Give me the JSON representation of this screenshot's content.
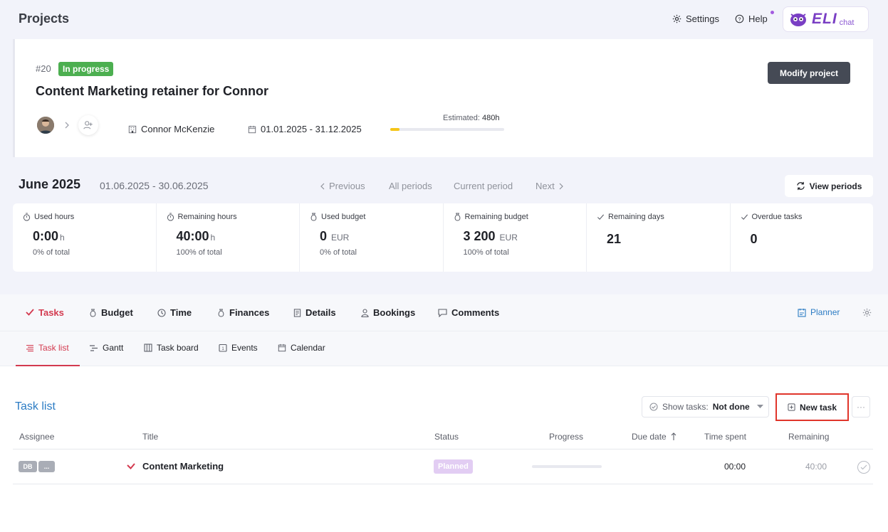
{
  "header": {
    "title": "Projects",
    "settings_label": "Settings",
    "help_label": "Help",
    "eli_brand": "ELI",
    "eli_chat": "chat"
  },
  "project": {
    "number": "#20",
    "status": "In progress",
    "title": "Content Marketing retainer for Connor",
    "client": "Connor McKenzie",
    "dates": "01.01.2025 - 31.12.2025",
    "estimated_label": "Estimated:",
    "estimated_value": "480h",
    "estimated_progress": 0.08,
    "modify_label": "Modify project"
  },
  "period": {
    "title": "June 2025",
    "range": "01.06.2025 - 30.06.2025",
    "previous": "Previous",
    "all": "All periods",
    "current": "Current period",
    "next": "Next",
    "view_periods": "View periods"
  },
  "stats": [
    {
      "label": "Used hours",
      "value": "0:00",
      "unit": "h",
      "sub": "0% of total"
    },
    {
      "label": "Remaining hours",
      "value": "40:00",
      "unit": "h",
      "sub": "100% of total"
    },
    {
      "label": "Used budget",
      "value": "0",
      "unit": "EUR",
      "sub": "0% of total"
    },
    {
      "label": "Remaining budget",
      "value": "3 200",
      "unit": "EUR",
      "sub": "100% of total"
    },
    {
      "label": "Remaining days",
      "value": "21"
    },
    {
      "label": "Overdue tasks",
      "value": "0"
    }
  ],
  "tabs": [
    "Tasks",
    "Budget",
    "Time",
    "Finances",
    "Details",
    "Bookings",
    "Comments"
  ],
  "planner_label": "Planner",
  "subtabs": [
    "Task list",
    "Gantt",
    "Task board",
    "Events",
    "Calendar"
  ],
  "tasklist": {
    "title": "Task list",
    "show_tasks_label": "Show tasks:",
    "show_tasks_value": "Not done",
    "new_task_label": "New task",
    "more_label": "···",
    "columns": [
      "Assignee",
      "Title",
      "Status",
      "Progress",
      "Due date",
      "Time spent",
      "Remaining"
    ],
    "rows": [
      {
        "assignee": "DB",
        "assignee_more": "...",
        "title": "Content Marketing",
        "status": "Planned",
        "progress": 0,
        "time_spent": "00:00",
        "remaining": "40:00"
      }
    ]
  },
  "colors": {
    "accent_red": "#d33a4f",
    "link_blue": "#2c7cc4",
    "status_green": "#4caf50",
    "planned_purple": "#e2cdf3",
    "highlight_red": "#e0352b"
  }
}
